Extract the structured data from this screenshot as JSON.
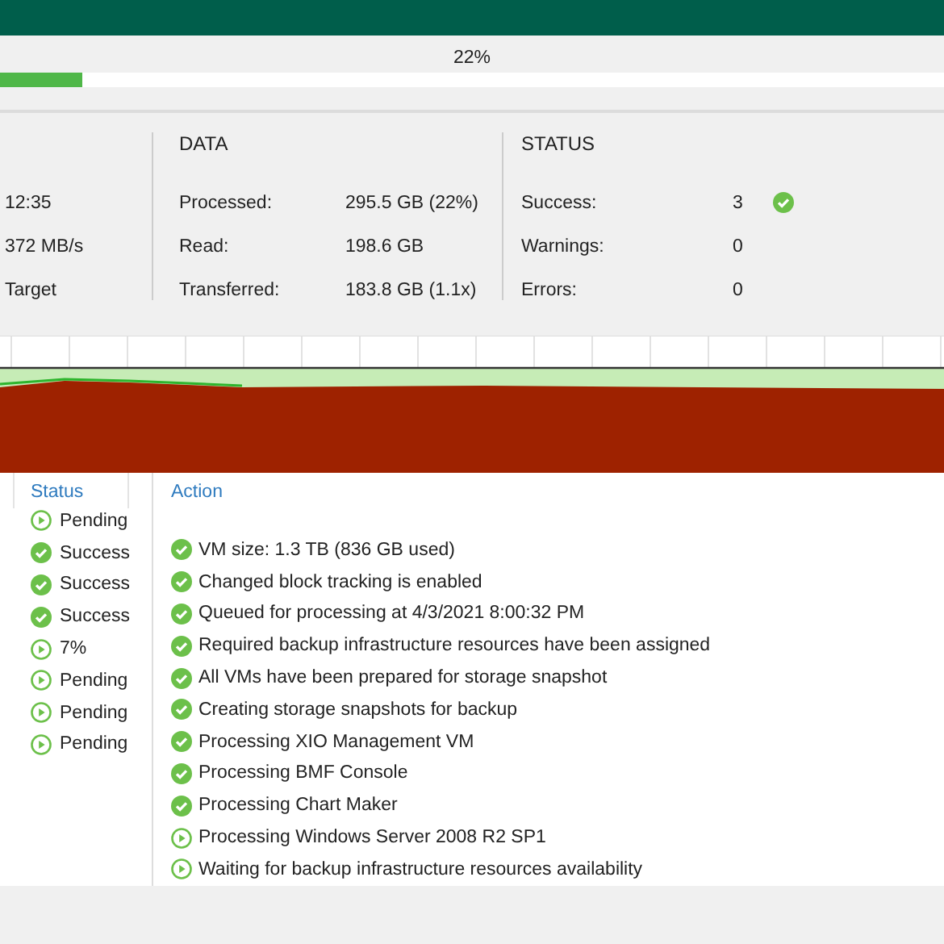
{
  "progress": {
    "label": "22%",
    "level": 0.087
  },
  "summary": {
    "left": [
      {
        "value": "12:35"
      },
      {
        "value": "372 MB/s"
      },
      {
        "value": "Target"
      }
    ],
    "data": {
      "title": "DATA",
      "rows": [
        {
          "label": "Processed:",
          "value": "295.5 GB (22%)"
        },
        {
          "label": "Read:",
          "value": "198.6 GB"
        },
        {
          "label": "Transferred:",
          "value": "183.8 GB (1.1x)"
        }
      ]
    },
    "status": {
      "title": "STATUS",
      "rows": [
        {
          "label": "Success:",
          "value": "3",
          "kind": "success"
        },
        {
          "label": "Warnings:",
          "value": "0",
          "kind": "none"
        },
        {
          "label": "Errors:",
          "value": "0",
          "kind": "none"
        }
      ]
    }
  },
  "vm_list": {
    "columns": [
      "Status"
    ],
    "rows": [
      {
        "kind": "pending",
        "status": "Pending"
      },
      {
        "kind": "success",
        "status": "Success"
      },
      {
        "kind": "success",
        "status": "Success"
      },
      {
        "kind": "success",
        "status": "Success"
      },
      {
        "kind": "pending",
        "status": "7%"
      },
      {
        "kind": "pending",
        "status": "Pending"
      },
      {
        "kind": "pending",
        "status": "Pending"
      },
      {
        "kind": "pending",
        "status": "Pending"
      }
    ]
  },
  "log": {
    "columns": [
      "Action"
    ],
    "rows": [
      {
        "kind": "success",
        "text": "VM size: 1.3 TB (836 GB used)"
      },
      {
        "kind": "success",
        "text": "Changed block tracking is enabled"
      },
      {
        "kind": "success",
        "text": "Queued for processing at 4/3/2021 8:00:32 PM"
      },
      {
        "kind": "success",
        "text": "Required backup infrastructure resources have been assigned"
      },
      {
        "kind": "success",
        "text": "All VMs have been prepared for storage snapshot"
      },
      {
        "kind": "success",
        "text": "Creating storage snapshots for backup"
      },
      {
        "kind": "success",
        "text": "Processing XIO Management VM"
      },
      {
        "kind": "success",
        "text": "Processing BMF Console"
      },
      {
        "kind": "success",
        "text": "Processing Chart Maker"
      },
      {
        "kind": "pending",
        "text": "Processing Windows Server 2008 R2 SP1"
      },
      {
        "kind": "pending",
        "text": "Waiting for backup infrastructure resources availability"
      }
    ]
  }
}
